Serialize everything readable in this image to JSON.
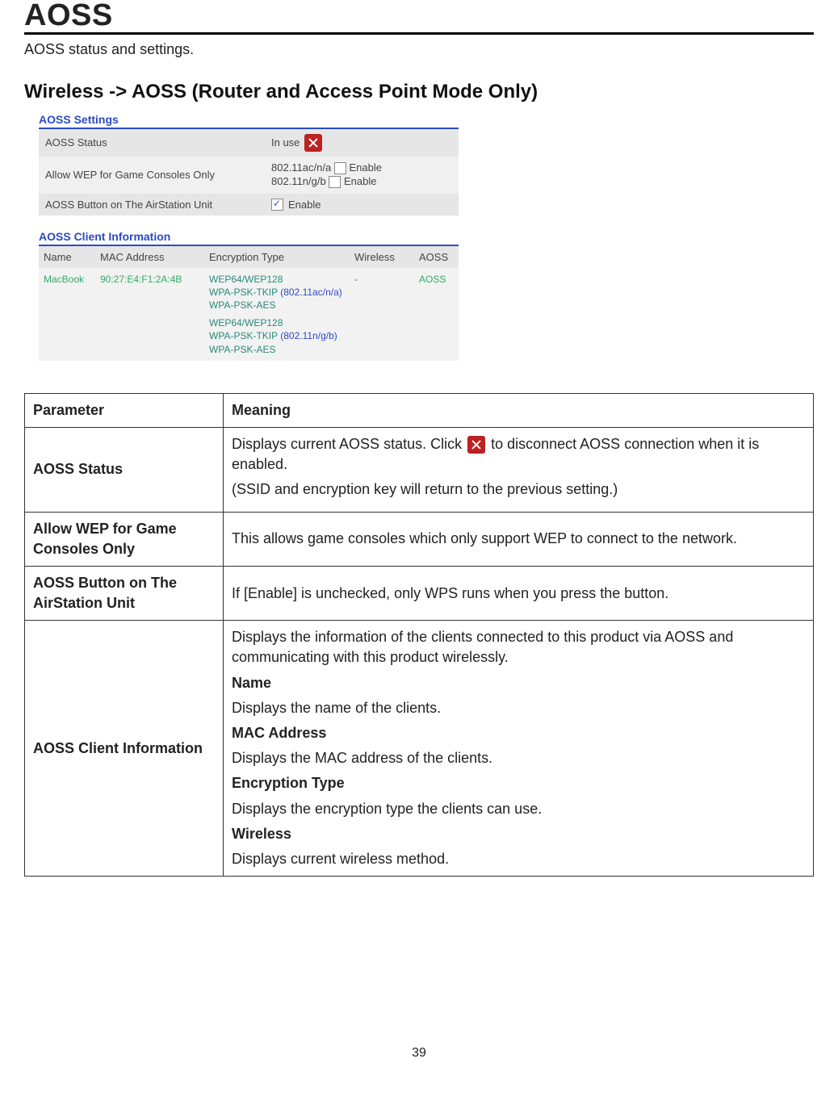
{
  "page": {
    "title": "AOSS",
    "subtitle": "AOSS status and settings.",
    "section_title": "Wireless -> AOSS (Router and Access Point Mode Only)",
    "page_number": "39"
  },
  "settings_panel": {
    "heading": "AOSS Settings",
    "rows": {
      "status_label": "AOSS Status",
      "status_value": "In use",
      "wep_label": "Allow WEP for Game Consoles Only",
      "wep_line1": "802.11ac/n/a",
      "wep_line2": "802.11n/g/b",
      "enable_text": "Enable",
      "button_label": "AOSS Button on The AirStation Unit"
    }
  },
  "client_panel": {
    "heading": "AOSS Client Information",
    "headers": {
      "name": "Name",
      "mac": "MAC Address",
      "enc": "Encryption Type",
      "wireless": "Wireless",
      "aoss": "AOSS"
    },
    "row": {
      "name": "MacBook",
      "mac": "90:27:E4:F1:2A:4B",
      "enc_a_l1": "WEP64/WEP128",
      "enc_a_l2": "WPA-PSK-TKIP",
      "enc_a_paren": "(802.11ac/n/a)",
      "enc_a_l3": "WPA-PSK-AES",
      "enc_b_l1": "WEP64/WEP128",
      "enc_b_l2": "WPA-PSK-TKIP",
      "enc_b_paren": "(802.11n/g/b)",
      "enc_b_l3": "WPA-PSK-AES",
      "wireless": "-",
      "aoss": "AOSS"
    }
  },
  "doc_table": {
    "headers": {
      "param": "Parameter",
      "meaning": "Meaning"
    },
    "rows": [
      {
        "param": "AOSS Status",
        "meaning_before_icon": "Displays current AOSS status. Click ",
        "meaning_after_icon": " to disconnect AOSS connection when it is enabled.",
        "meaning_line2": "(SSID and encryption key will return to the previous setting.)"
      },
      {
        "param": "Allow WEP for Game Consoles Only",
        "meaning": "This allows game consoles which only support WEP to connect to the network."
      },
      {
        "param": "AOSS Button on The AirStation Unit",
        "meaning": "If [Enable] is unchecked, only WPS runs when you press the button."
      },
      {
        "param": "AOSS Client Information",
        "intro": "Displays the information of the clients connected to this product via AOSS and communicating with this product wirelessly.",
        "name_label": "Name",
        "name_text": "Displays the name of the clients.",
        "mac_label": "MAC Address",
        "mac_text": "Displays the MAC address of the clients.",
        "enc_label": "Encryption Type",
        "enc_text": "Displays the encryption type the clients can use.",
        "wireless_label": "Wireless",
        "wireless_text": "Displays current wireless method."
      }
    ]
  }
}
